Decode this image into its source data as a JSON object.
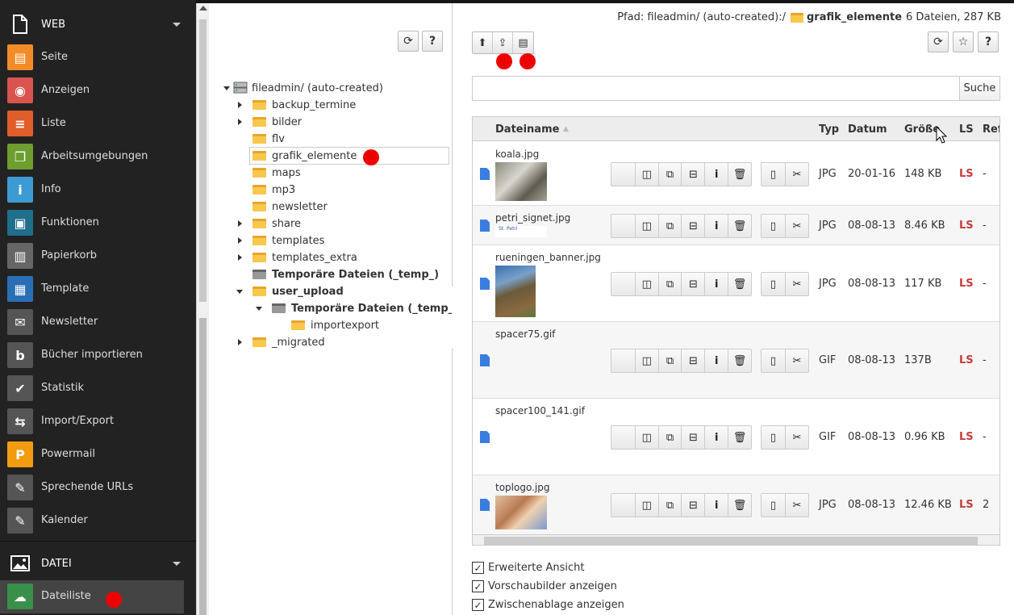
{
  "menu": {
    "web_label": "WEB",
    "datei_label": "DATEI",
    "items": [
      {
        "label": "Seite",
        "color": "#f28c29",
        "icon": "page-icon"
      },
      {
        "label": "Anzeigen",
        "color": "#d9534f",
        "icon": "eye-icon"
      },
      {
        "label": "Liste",
        "color": "#e15d2a",
        "icon": "list-icon"
      },
      {
        "label": "Arbeitsumgebungen",
        "color": "#6f9d2f",
        "icon": "workspace-icon"
      },
      {
        "label": "Info",
        "color": "#3d9bd4",
        "icon": "info-icon"
      },
      {
        "label": "Funktionen",
        "color": "#1f6e8c",
        "icon": "toolbox-icon"
      },
      {
        "label": "Papierkorb",
        "color": "#666666",
        "icon": "trash-icon"
      },
      {
        "label": "Template",
        "color": "#2a6fb5",
        "icon": "template-icon"
      },
      {
        "label": "Newsletter",
        "color": "#555555",
        "icon": "newsletter-icon"
      },
      {
        "label": "Bücher importieren",
        "color": "#555555",
        "icon": "book-import-icon"
      },
      {
        "label": "Statistik",
        "color": "#555555",
        "icon": "statistics-icon"
      },
      {
        "label": "Import/Export",
        "color": "#555555",
        "icon": "import-export-icon"
      },
      {
        "label": "Powermail",
        "color": "#f39c12",
        "icon": "powermail-icon"
      },
      {
        "label": "Sprechende URLs",
        "color": "#555555",
        "icon": "url-icon"
      },
      {
        "label": "Kalender",
        "color": "#555555",
        "icon": "calendar-icon"
      }
    ],
    "dateiliste": {
      "label": "Dateiliste",
      "color": "#3a8f4b",
      "icon": "filelist-icon"
    }
  },
  "tree": {
    "root": "fileadmin/ (auto-created)",
    "nodes": [
      {
        "label": "backup_termine"
      },
      {
        "label": "bilder"
      },
      {
        "label": "flv"
      },
      {
        "label": "grafik_elemente"
      },
      {
        "label": "maps"
      },
      {
        "label": "mp3"
      },
      {
        "label": "newsletter"
      },
      {
        "label": "share"
      },
      {
        "label": "templates"
      },
      {
        "label": "templates_extra"
      },
      {
        "label": "Temporäre Dateien (_temp_)"
      },
      {
        "label": "user_upload"
      },
      {
        "label": "Temporäre Dateien (_temp_)"
      },
      {
        "label": "importexport"
      },
      {
        "label": "_migrated"
      }
    ]
  },
  "main": {
    "path_prefix": "Pfad: fileadmin/ (auto-created):/",
    "path_folder": "grafik_elemente",
    "path_info": "6 Dateien, 287 KB",
    "search_label": "Suche",
    "search_value": "",
    "headers": {
      "name": "Dateiname",
      "typ": "Typ",
      "datum": "Datum",
      "groesse": "Größe",
      "ls": "LS",
      "ref": "Ref"
    },
    "files": [
      {
        "name": "koala.jpg",
        "typ": "JPG",
        "datum": "20-01-16",
        "size": "148 KB",
        "ls": "LS",
        "ref": "-"
      },
      {
        "name": "petri_signet.jpg",
        "typ": "JPG",
        "datum": "08-08-13",
        "size": "8.46 KB",
        "ls": "LS",
        "ref": "-",
        "thumb_text": "St. Petri"
      },
      {
        "name": "rueningen_banner.jpg",
        "typ": "JPG",
        "datum": "08-08-13",
        "size": "117 KB",
        "ls": "LS",
        "ref": "-"
      },
      {
        "name": "spacer75.gif",
        "typ": "GIF",
        "datum": "08-08-13",
        "size": "137B",
        "ls": "LS",
        "ref": "-"
      },
      {
        "name": "spacer100_141.gif",
        "typ": "GIF",
        "datum": "08-08-13",
        "size": "0.96 KB",
        "ls": "LS",
        "ref": "-"
      },
      {
        "name": "toplogo.jpg",
        "typ": "JPG",
        "datum": "08-08-13",
        "size": "12.46 KB",
        "ls": "LS",
        "ref": "2"
      }
    ],
    "options": [
      "Erweiterte Ansicht",
      "Vorschaubilder anzeigen",
      "Zwischenablage anzeigen"
    ]
  }
}
